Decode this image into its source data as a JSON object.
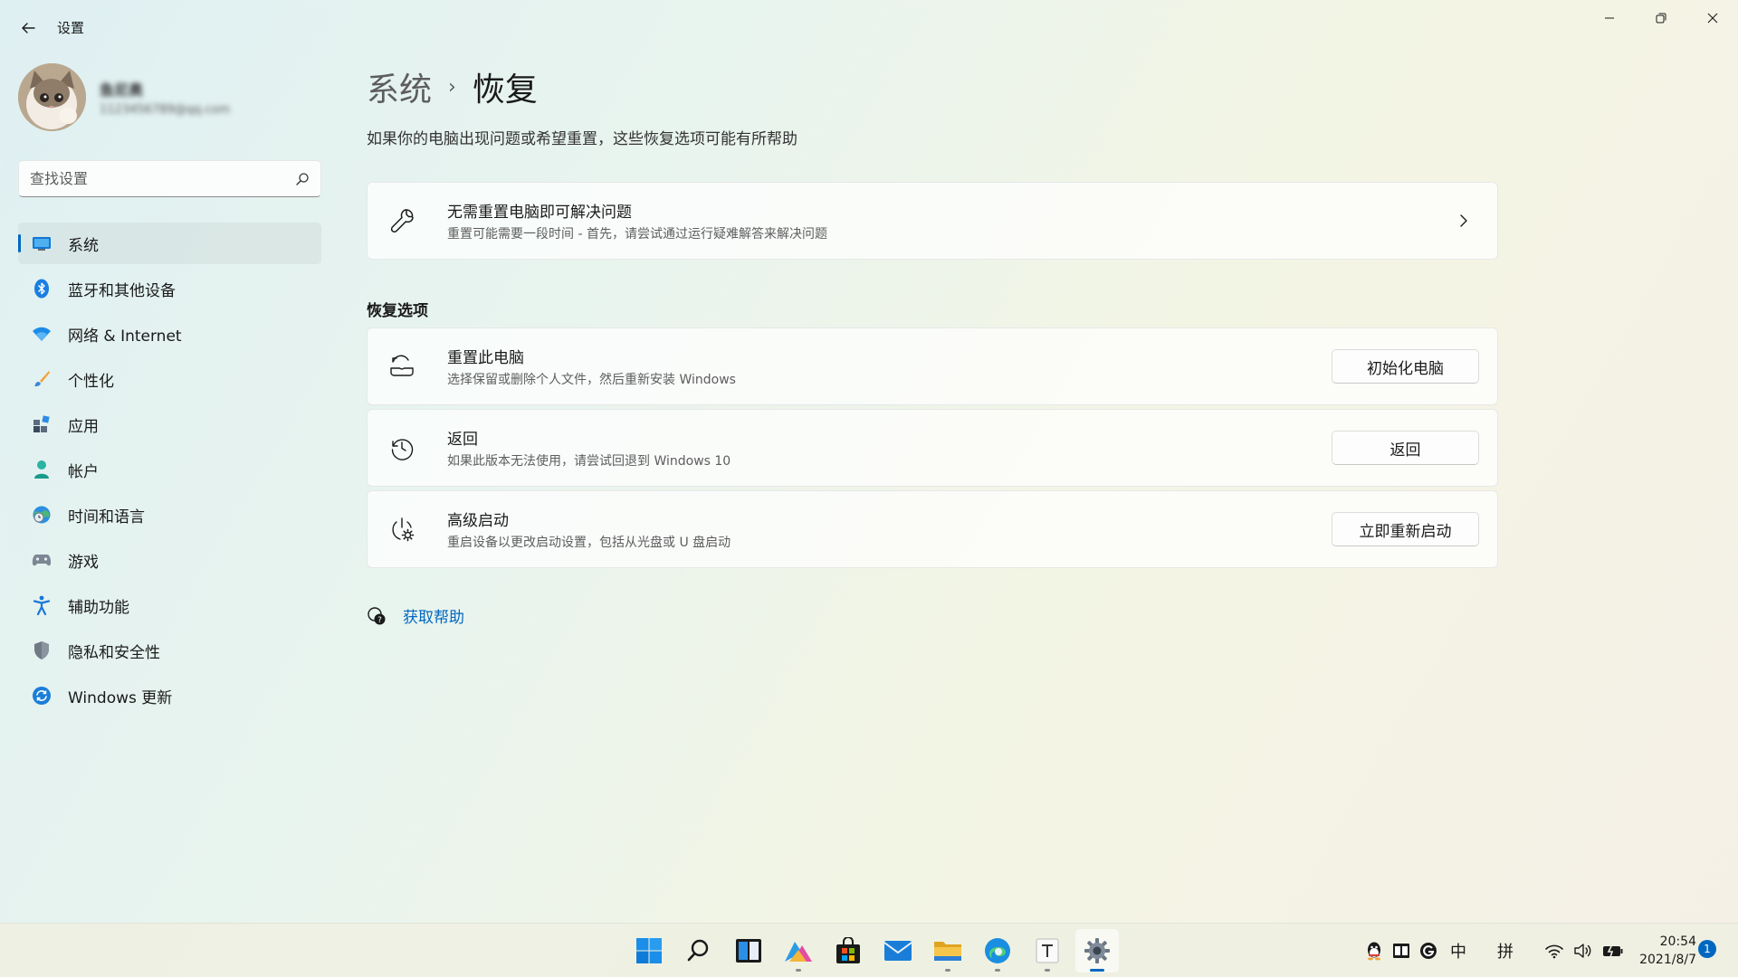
{
  "window": {
    "title": "设置",
    "accent": "#0067c0"
  },
  "profile": {
    "name": "鱼尼奥",
    "email": "1123456789@qq.com"
  },
  "search": {
    "placeholder": "查找设置"
  },
  "nav": {
    "items": [
      {
        "label": "系统",
        "icon": "monitor-icon",
        "active": true
      },
      {
        "label": "蓝牙和其他设备",
        "icon": "bluetooth-icon"
      },
      {
        "label": "网络 & Internet",
        "icon": "wifi-icon"
      },
      {
        "label": "个性化",
        "icon": "brush-icon"
      },
      {
        "label": "应用",
        "icon": "apps-icon"
      },
      {
        "label": "帐户",
        "icon": "person-icon"
      },
      {
        "label": "时间和语言",
        "icon": "globe-clock-icon"
      },
      {
        "label": "游戏",
        "icon": "gamepad-icon"
      },
      {
        "label": "辅助功能",
        "icon": "accessibility-icon"
      },
      {
        "label": "隐私和安全性",
        "icon": "shield-icon"
      },
      {
        "label": "Windows 更新",
        "icon": "update-icon"
      }
    ]
  },
  "main": {
    "breadcrumb_parent": "系统",
    "breadcrumb_sep": "›",
    "breadcrumb_current": "恢复",
    "subtitle": "如果你的电脑出现问题或希望重置，这些恢复选项可能有所帮助",
    "troubleshoot": {
      "title": "无需重置电脑即可解决问题",
      "desc": "重置可能需要一段时间 - 首先，请尝试通过运行疑难解答来解决问题"
    },
    "section_title": "恢复选项",
    "options": [
      {
        "title": "重置此电脑",
        "desc": "选择保留或删除个人文件，然后重新安装 Windows",
        "button": "初始化电脑"
      },
      {
        "title": "返回",
        "desc": "如果此版本无法使用，请尝试回退到 Windows 10",
        "button": "返回"
      },
      {
        "title": "高级启动",
        "desc": "重启设备以更改启动设置，包括从光盘或 U 盘启动",
        "button": "立即重新启动"
      }
    ],
    "help_label": "获取帮助"
  },
  "taskbar": {
    "tray": {
      "ime_lang": "中",
      "ime_mode": "拼"
    },
    "time": "20:54",
    "date": "2021/8/7",
    "notifications": "1"
  }
}
